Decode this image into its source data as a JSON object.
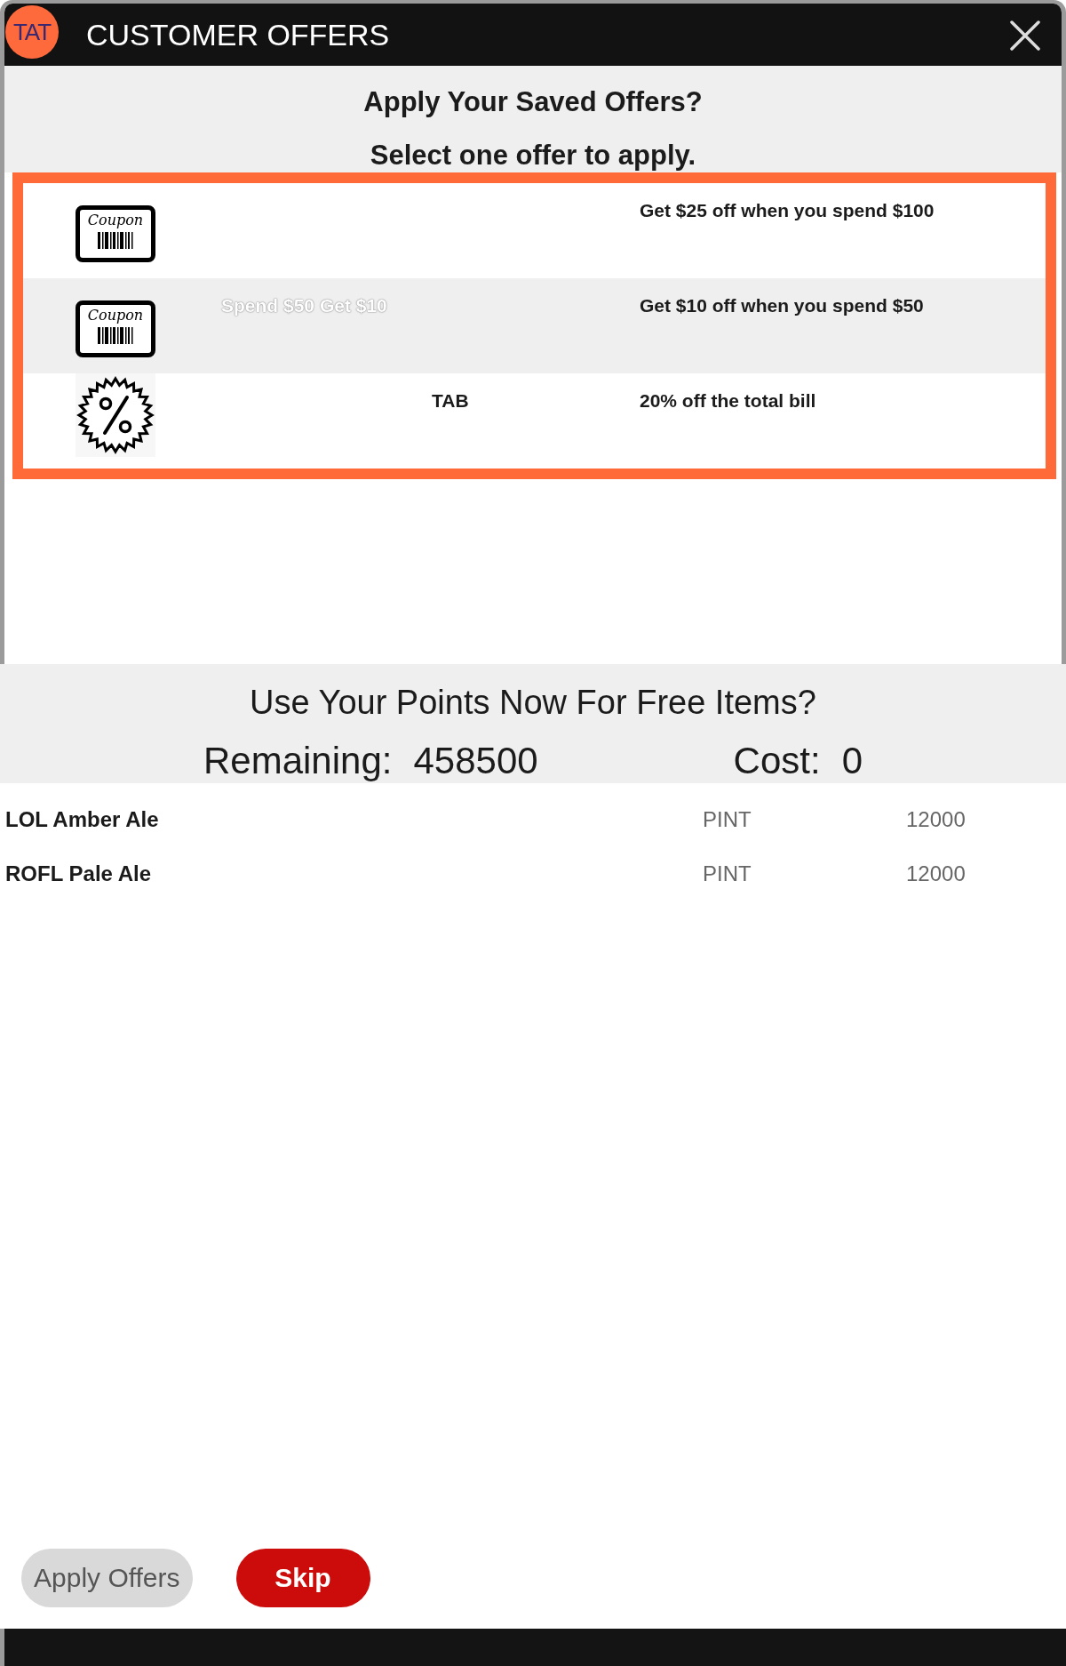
{
  "header": {
    "logo_text": "TAT",
    "title": "CUSTOMER OFFERS"
  },
  "offers_intro": {
    "heading": "Apply Your Saved Offers?",
    "instruction": "Select one offer to apply."
  },
  "offers": [
    {
      "kind": "coupon",
      "icon_label": "Coupon",
      "description": "Get $25 off when you spend $100"
    },
    {
      "kind": "coupon",
      "icon_label": "Coupon",
      "name": "Spend $50 Get $10",
      "description": "Get $10 off when you spend $50"
    },
    {
      "kind": "percent",
      "type": "TAB",
      "description": "20% off the total bill"
    }
  ],
  "points": {
    "heading": "Use Your Points Now For Free Items?",
    "remaining_label": "Remaining:",
    "remaining_value": "458500",
    "cost_label": "Cost:",
    "cost_value": "0"
  },
  "reward_items": [
    {
      "name": "LOL Amber Ale",
      "unit": "PINT",
      "points": "12000"
    },
    {
      "name": "ROFL Pale Ale",
      "unit": "PINT",
      "points": "12000"
    }
  ],
  "buttons": [
    {
      "label": "Apply Offers",
      "disabled": true
    },
    {
      "label": "Skip",
      "disabled": false
    }
  ]
}
